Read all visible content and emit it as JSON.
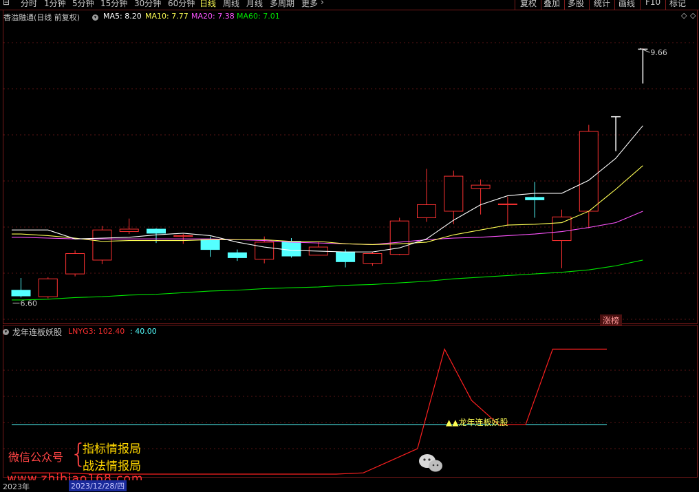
{
  "toolbar": {
    "tabs": [
      "分时",
      "1分钟",
      "5分钟",
      "15分钟",
      "30分钟",
      "60分钟",
      "日线",
      "周线",
      "月线",
      "多周期",
      "更多"
    ],
    "active_tab": "日线",
    "right_buttons": [
      "复权",
      "叠加",
      "多股",
      "统计",
      "画线",
      "F10",
      "标记"
    ]
  },
  "main": {
    "stock_title": "香溢融通(日线 前复权)",
    "ma": [
      {
        "label": "MA5: 8.20",
        "color": "#ffffff"
      },
      {
        "label": "MA10: 7.77",
        "color": "#ffff54"
      },
      {
        "label": "MA20: 7.38",
        "color": "#ff54ff"
      },
      {
        "label": "MA60: 7.01",
        "color": "#00e600"
      }
    ],
    "high_label": "9.66",
    "low_label": "6.60",
    "tag_label": "涨榜"
  },
  "chart_data": {
    "type": "candlestick",
    "ylim": [
      6.35,
      10.0
    ],
    "high_marker": 9.66,
    "low_marker": 6.6,
    "candles": [
      {
        "o": 6.69,
        "h": 6.84,
        "l": 6.6,
        "c": 6.62
      },
      {
        "o": 6.61,
        "h": 6.85,
        "l": 6.59,
        "c": 6.83
      },
      {
        "o": 6.89,
        "h": 7.18,
        "l": 6.86,
        "c": 7.14
      },
      {
        "o": 7.06,
        "h": 7.48,
        "l": 7.01,
        "c": 7.43
      },
      {
        "o": 7.41,
        "h": 7.57,
        "l": 7.38,
        "c": 7.44
      },
      {
        "o": 7.44,
        "h": 7.45,
        "l": 7.27,
        "c": 7.39
      },
      {
        "o": 7.35,
        "h": 7.38,
        "l": 7.26,
        "c": 7.36
      },
      {
        "o": 7.31,
        "h": 7.35,
        "l": 7.1,
        "c": 7.19
      },
      {
        "o": 7.15,
        "h": 7.19,
        "l": 7.05,
        "c": 7.09
      },
      {
        "o": 7.07,
        "h": 7.35,
        "l": 7.02,
        "c": 7.28
      },
      {
        "o": 7.29,
        "h": 7.33,
        "l": 7.09,
        "c": 7.11
      },
      {
        "o": 7.12,
        "h": 7.28,
        "l": 7.12,
        "c": 7.22
      },
      {
        "o": 7.16,
        "h": 7.19,
        "l": 6.97,
        "c": 7.04
      },
      {
        "o": 7.02,
        "h": 7.16,
        "l": 6.99,
        "c": 7.14
      },
      {
        "o": 7.13,
        "h": 7.58,
        "l": 7.12,
        "c": 7.54
      },
      {
        "o": 7.58,
        "h": 8.18,
        "l": 7.53,
        "c": 7.74
      },
      {
        "o": 7.66,
        "h": 8.16,
        "l": 7.5,
        "c": 8.09
      },
      {
        "o": 7.94,
        "h": 8.05,
        "l": 7.62,
        "c": 7.98
      },
      {
        "o": 7.74,
        "h": 7.84,
        "l": 7.48,
        "c": 7.75
      },
      {
        "o": 7.83,
        "h": 8.02,
        "l": 7.58,
        "c": 7.8
      },
      {
        "o": 7.3,
        "h": 7.68,
        "l": 6.96,
        "c": 7.59
      },
      {
        "o": 7.66,
        "h": 8.72,
        "l": 7.45,
        "c": 8.64
      },
      {
        "o": 8.81,
        "h": 8.82,
        "l": 8.81,
        "c": 8.82
      },
      {
        "o": 9.64,
        "h": 9.66,
        "l": 9.64,
        "c": 9.65
      }
    ],
    "ma5": [
      null,
      7.43,
      7.32,
      7.33,
      7.34,
      7.37,
      7.39,
      7.36,
      7.28,
      7.22,
      7.18,
      7.17,
      7.16,
      7.16,
      7.21,
      7.32,
      7.55,
      7.74,
      7.85,
      7.88,
      7.88,
      8.04,
      8.31,
      8.71
    ],
    "ma10": [
      7.38,
      7.36,
      7.33,
      7.29,
      7.3,
      7.3,
      7.3,
      7.31,
      7.31,
      7.31,
      7.29,
      7.29,
      7.26,
      7.25,
      7.26,
      7.28,
      7.37,
      7.43,
      7.49,
      7.5,
      7.52,
      7.66,
      7.93,
      8.22
    ],
    "ma20": [
      7.34,
      7.33,
      7.32,
      7.32,
      7.32,
      7.32,
      7.32,
      7.32,
      7.31,
      7.3,
      7.28,
      7.27,
      7.26,
      7.25,
      7.28,
      7.31,
      7.33,
      7.34,
      7.36,
      7.38,
      7.41,
      7.46,
      7.52,
      7.66
    ],
    "ma60": [
      6.57,
      6.58,
      6.6,
      6.61,
      6.63,
      6.64,
      6.66,
      6.68,
      6.69,
      6.71,
      6.72,
      6.73,
      6.75,
      6.76,
      6.78,
      6.8,
      6.83,
      6.85,
      6.87,
      6.89,
      6.91,
      6.94,
      6.99,
      7.06
    ]
  },
  "indicator": {
    "name": "龙年连板妖股",
    "lnyg3_label": "LNYG3: 102.40",
    "level_label": ": 40.00",
    "signal_label": "▲▲龙年连板妖股",
    "lnyg3": [
      0,
      0,
      0,
      -1,
      -1,
      -1,
      -1,
      -1,
      -1,
      -1,
      -1,
      -1,
      -1,
      0,
      10,
      20,
      102.4,
      60,
      40,
      40,
      102.4,
      102.4,
      102.4
    ],
    "level": 40,
    "ylim": [
      -5,
      110
    ]
  },
  "watermark": {
    "account_label": "微信公众号",
    "line1": "指标情报局",
    "line2": "战法情报局",
    "url": "www.zhibiao168.com"
  },
  "datebar": {
    "year": "2023年",
    "date": "2023/12/28/四"
  }
}
